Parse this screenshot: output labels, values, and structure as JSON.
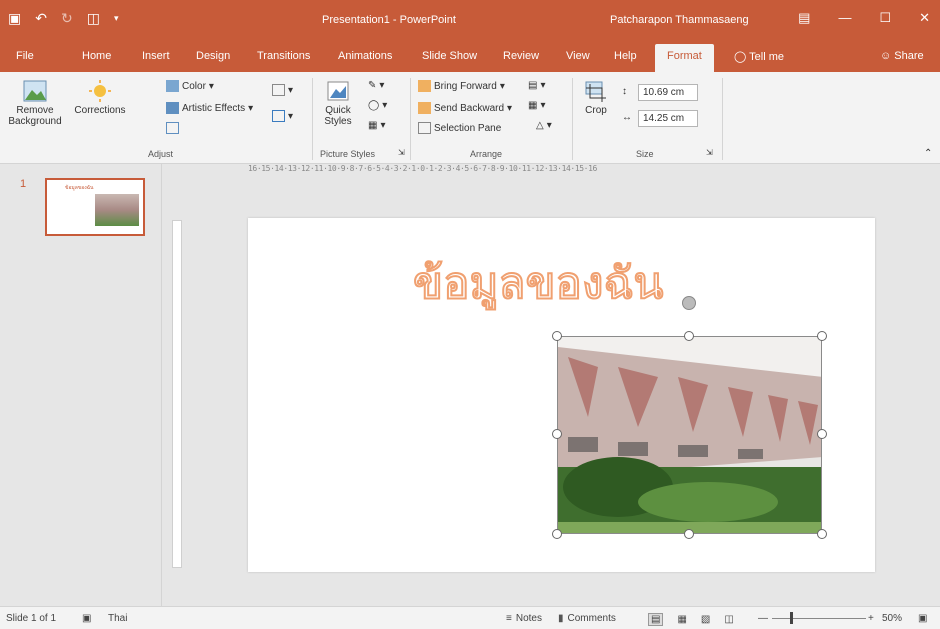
{
  "titlebar": {
    "document_title": "Presentation1 - PowerPoint",
    "user_name": "Patcharapon Thammasaeng",
    "qat_icons": [
      "save-icon",
      "undo-icon",
      "redo-icon",
      "present-icon",
      "customize-icon"
    ],
    "window_buttons": [
      "ribbon-display-icon",
      "minimize-icon",
      "restore-icon",
      "close-icon"
    ]
  },
  "tabs": [
    "File",
    "Home",
    "Insert",
    "Design",
    "Transitions",
    "Animations",
    "Slide Show",
    "Review",
    "View",
    "Help",
    "Format"
  ],
  "active_tab": "Format",
  "tell_me": "Tell me",
  "share": "Share",
  "ribbon": {
    "adjust": {
      "remove_background": "Remove Background",
      "corrections": "Corrections",
      "color": "Color",
      "artistic_effects": "Artistic Effects",
      "label": "Adjust"
    },
    "picture_styles": {
      "quick_styles": "Quick Styles",
      "label": "Picture Styles"
    },
    "arrange": {
      "bring_forward": "Bring Forward",
      "send_backward": "Send Backward",
      "selection_pane": "Selection Pane",
      "label": "Arrange"
    },
    "size": {
      "crop": "Crop",
      "height": "10.69 cm",
      "width": "14.25 cm",
      "label": "Size"
    }
  },
  "ruler_h": "16·15·14·13·12·11·10·9·8·7·6·5·4·3·2·1·0·1·2·3·4·5·6·7·8·9·10·11·12·13·14·15·16",
  "thumbnail": {
    "number": "1",
    "title": "ข้อมูลของฉัน"
  },
  "slide": {
    "title": "ข้อมูลของฉัน"
  },
  "status": {
    "slide_info": "Slide 1 of 1",
    "language": "Thai",
    "notes": "Notes",
    "comments": "Comments",
    "zoom": "50%"
  },
  "colors": {
    "accent": "#c75b39",
    "title_text": "#f0a070"
  }
}
